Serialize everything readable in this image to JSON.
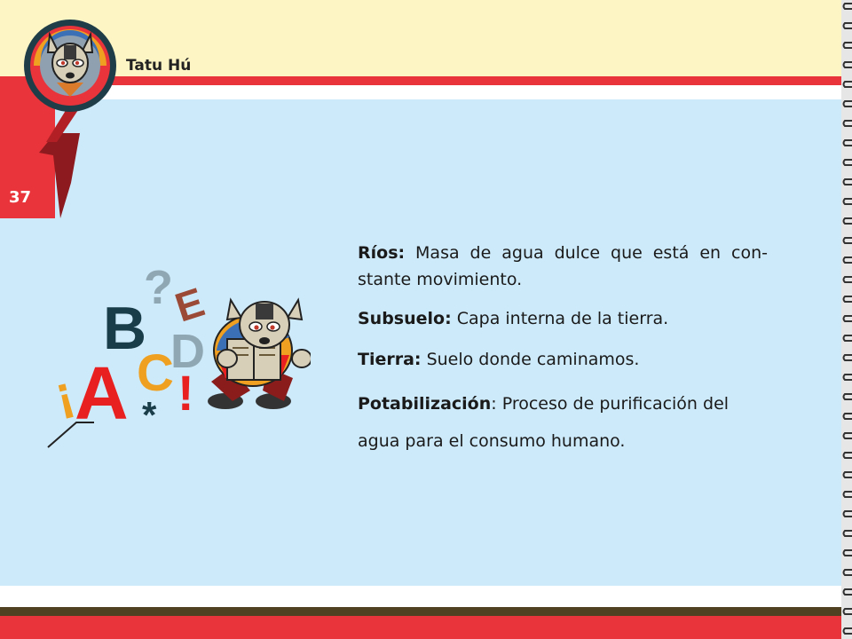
{
  "header": {
    "title": "Tatu Hú"
  },
  "page": {
    "number": "37"
  },
  "glossary": [
    {
      "term": "Ríos:",
      "definition": " Masa de agua dulce que está en con- stante movimiento."
    },
    {
      "term": "Subsuelo:",
      "definition": " Capa interna de la tierra."
    },
    {
      "term": "Tierra:",
      "definition": " Suelo donde caminamos."
    },
    {
      "term": "Potabilización",
      "definition": ": Proceso de purificación del",
      "definition_cont": "agua para el consumo humano."
    }
  ],
  "illustration": {
    "letters": [
      "?",
      "B",
      "E",
      "D",
      "¡",
      "A",
      "C",
      "*",
      "!"
    ]
  },
  "colors": {
    "red": "#e8343a",
    "cream": "#fdf5c4",
    "panel": "#cdeafa",
    "brown": "#4f4121"
  }
}
